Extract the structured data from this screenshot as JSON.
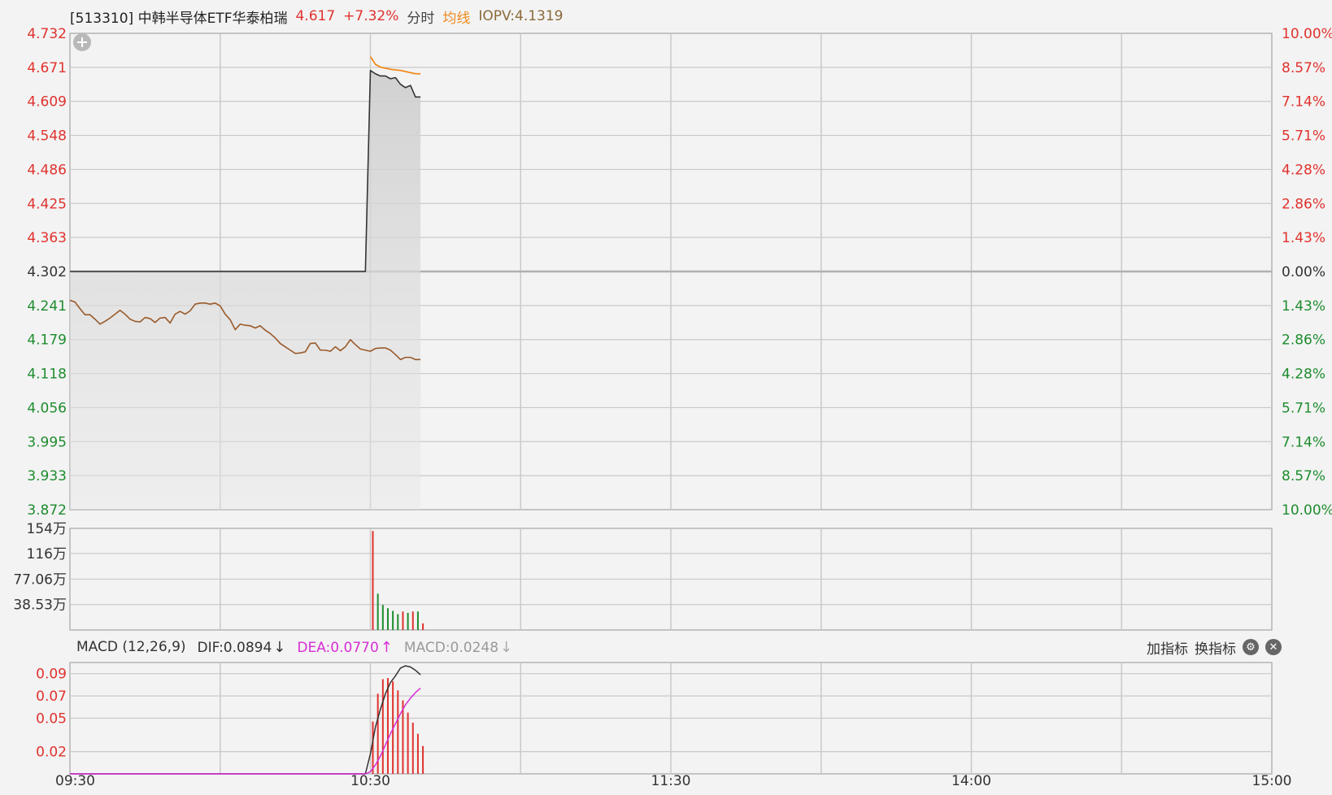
{
  "header": {
    "title": "[513310] 中韩半导体ETF华泰柏瑞",
    "price": "4.617",
    "change": "+7.32%",
    "mode": "分时",
    "avg_label": "均线",
    "iopv": "IOPV:4.1319"
  },
  "macd_header": {
    "name": "MACD (12,26,9)",
    "dif": "DIF:0.0894",
    "dea": "DEA:0.0770",
    "macd": "MACD:0.0248",
    "dif_arrow": "↓",
    "dea_arrow": "↑",
    "macd_arrow": "↓"
  },
  "tools": {
    "add_indicator": "加指标",
    "switch_indicator": "换指标"
  },
  "colors": {
    "up": "#e0322e",
    "down": "#1e8c2e",
    "price_line": "#333333",
    "avg_line": "#f08a1c",
    "iopv_line": "#9a5a2a",
    "dif_line": "#333333",
    "dea_line": "#d62ed6",
    "grid": "#c9c9c9"
  },
  "chart_data": [
    {
      "type": "line",
      "panel": "price",
      "base": 4.302,
      "y_ticks_left": [
        "4.732",
        "4.671",
        "4.609",
        "4.548",
        "4.486",
        "4.425",
        "4.363",
        "4.302",
        "4.241",
        "4.179",
        "4.118",
        "4.056",
        "3.995",
        "3.933",
        "3.872"
      ],
      "y_ticks_right": [
        "10.00%",
        "8.57%",
        "7.14%",
        "5.71%",
        "4.28%",
        "2.86%",
        "1.43%",
        "0.00%",
        "1.43%",
        "2.86%",
        "4.28%",
        "5.71%",
        "7.14%",
        "8.57%",
        "10.00%"
      ],
      "ylim": [
        3.872,
        4.732
      ],
      "xlim": [
        0,
        240
      ],
      "x_ticks": [
        "09:30",
        "10:30",
        "11:30",
        "14:00",
        "15:00"
      ],
      "series": [
        {
          "x": [
            0,
            59,
            60,
            61,
            62,
            63,
            64,
            65,
            66,
            67,
            68,
            69,
            70
          ],
          "values": [
            4.302,
            4.302,
            4.665,
            4.659,
            4.655,
            4.655,
            4.65,
            4.652,
            4.64,
            4.634,
            4.638,
            4.617,
            4.617
          ]
        },
        {
          "x": [
            60,
            61,
            62,
            63,
            64,
            65,
            66,
            67,
            68,
            69,
            70
          ],
          "values": [
            4.69,
            4.676,
            4.671,
            4.669,
            4.667,
            4.666,
            4.665,
            4.663,
            4.661,
            4.659,
            4.659
          ]
        },
        {
          "x": [
            0,
            1,
            2,
            3,
            4,
            5,
            6,
            7,
            8,
            9,
            10,
            11,
            12,
            13,
            14,
            15,
            16,
            17,
            18,
            19,
            20,
            21,
            22,
            23,
            24,
            25,
            26,
            27,
            28,
            29,
            30,
            31,
            32,
            33,
            34,
            35,
            36,
            37,
            38,
            39,
            40,
            41,
            42,
            43,
            44,
            45,
            46,
            47,
            48,
            49,
            50,
            51,
            52,
            53,
            54,
            55,
            56,
            57,
            58,
            59,
            60,
            61,
            62,
            63,
            64,
            65,
            66,
            67,
            68,
            69,
            70
          ],
          "values": [
            4.25,
            4.247,
            4.235,
            4.224,
            4.224,
            4.216,
            4.207,
            4.212,
            4.218,
            4.225,
            4.232,
            4.225,
            4.216,
            4.212,
            4.211,
            4.219,
            4.217,
            4.21,
            4.218,
            4.219,
            4.209,
            4.225,
            4.23,
            4.225,
            4.231,
            4.243,
            4.245,
            4.245,
            4.243,
            4.245,
            4.24,
            4.225,
            4.215,
            4.197,
            4.207,
            4.205,
            4.204,
            4.2,
            4.204,
            4.196,
            4.19,
            4.182,
            4.172,
            4.166,
            4.16,
            4.154,
            4.155,
            4.157,
            4.172,
            4.173,
            4.16,
            4.16,
            4.158,
            4.166,
            4.159,
            4.166,
            4.179,
            4.17,
            4.162,
            4.16,
            4.158,
            4.163,
            4.164,
            4.164,
            4.16,
            4.152,
            4.143,
            4.147,
            4.147,
            4.143,
            4.143
          ]
        }
      ]
    },
    {
      "type": "bar",
      "panel": "volume",
      "y_ticks": [
        "154万",
        "116万",
        "77.06万",
        "38.53万"
      ],
      "ylim": [
        0,
        154
      ],
      "x": [
        60,
        61,
        62,
        63,
        64,
        65,
        66,
        67,
        68,
        69,
        70
      ],
      "values": [
        150,
        55,
        38,
        33,
        29,
        24,
        28,
        26,
        28,
        28,
        10
      ],
      "directions": [
        "up",
        "down",
        "down",
        "down",
        "down",
        "down",
        "up",
        "down",
        "up",
        "down",
        "up"
      ]
    },
    {
      "type": "bar",
      "panel": "macd",
      "y_ticks": [
        "0.09",
        "0.07",
        "0.05",
        "0.02"
      ],
      "ylim": [
        0,
        0.1
      ],
      "x": [
        60,
        61,
        62,
        63,
        64,
        65,
        66,
        67,
        68,
        69,
        70
      ],
      "values": [
        0.047,
        0.072,
        0.085,
        0.086,
        0.083,
        0.075,
        0.066,
        0.055,
        0.046,
        0.036,
        0.025
      ],
      "series": [
        {
          "x": [
            0,
            59,
            60,
            61,
            62,
            63,
            64,
            65,
            66,
            67,
            68,
            69,
            70
          ],
          "values": [
            0,
            0,
            0.018,
            0.042,
            0.058,
            0.072,
            0.082,
            0.088,
            0.095,
            0.097,
            0.096,
            0.093,
            0.089
          ]
        },
        {
          "x": [
            0,
            59,
            60,
            61,
            62,
            63,
            64,
            65,
            66,
            67,
            68,
            69,
            70
          ],
          "values": [
            0,
            0,
            0.002,
            0.008,
            0.016,
            0.026,
            0.036,
            0.045,
            0.054,
            0.062,
            0.068,
            0.073,
            0.077
          ]
        }
      ]
    }
  ]
}
